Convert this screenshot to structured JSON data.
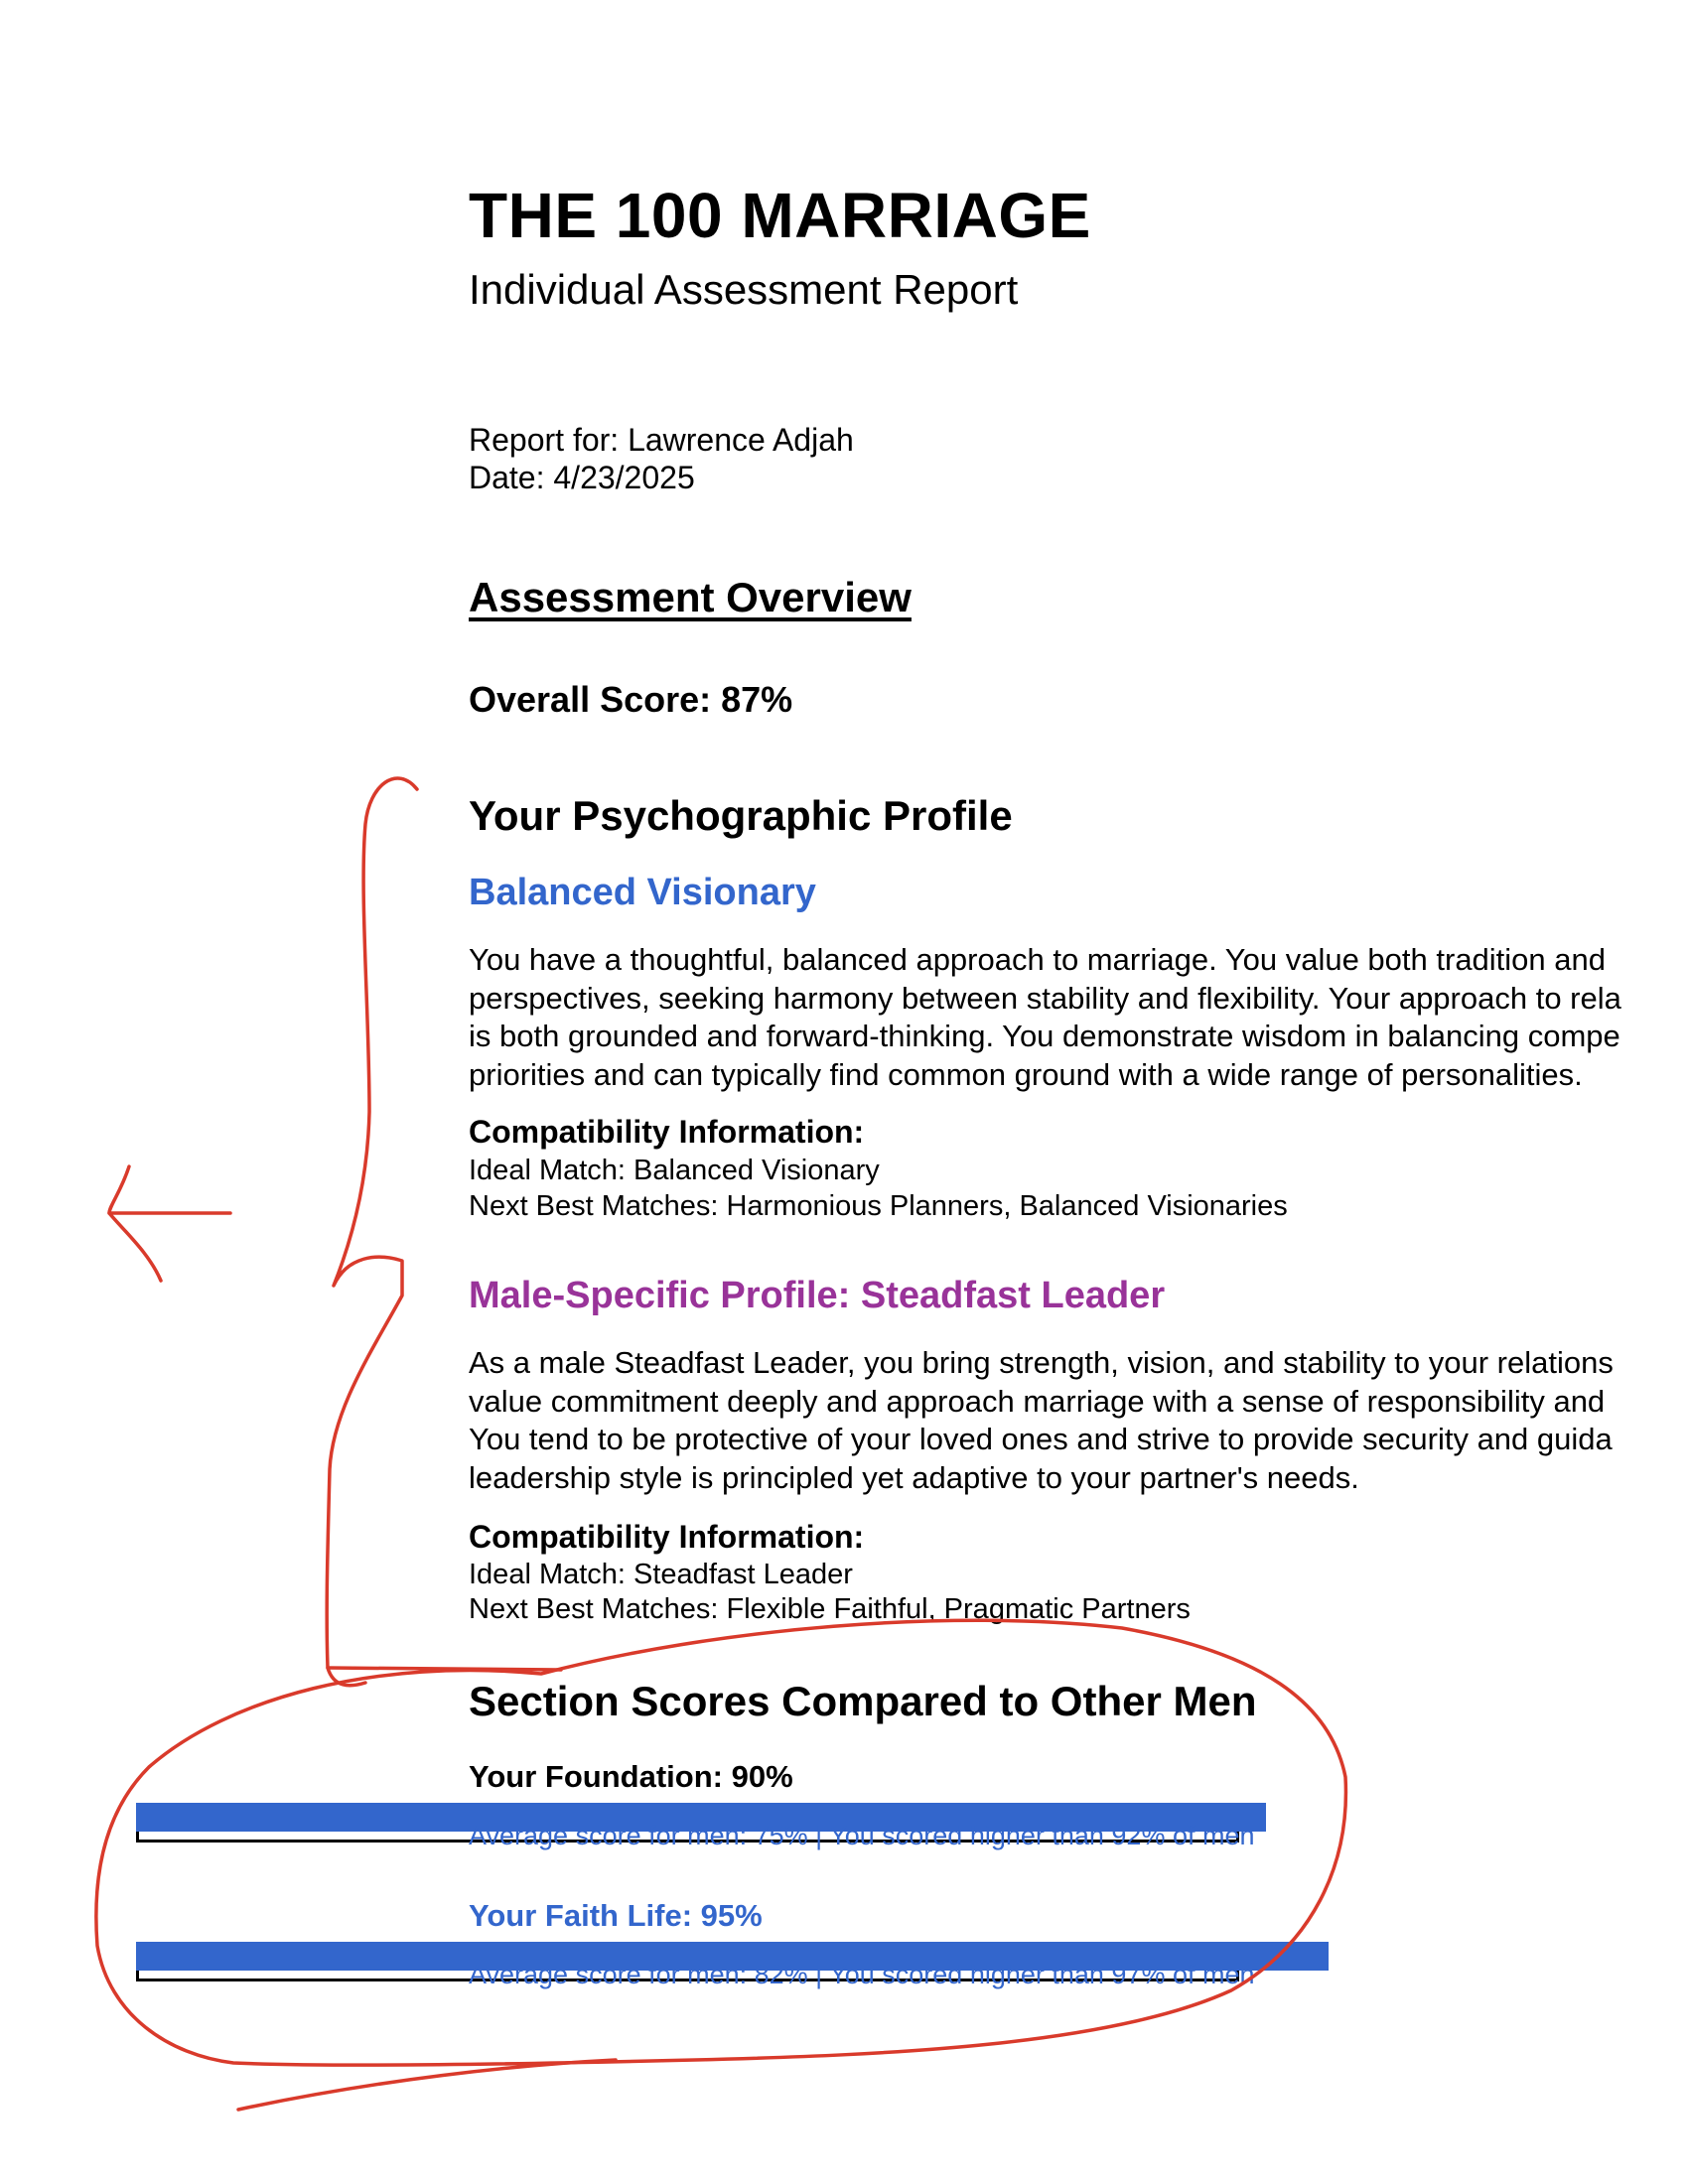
{
  "report": {
    "title": "THE 100 MARRIAGE",
    "subtitle": "Individual Assessment Report",
    "report_for": "Report for: Lawrence Adjah",
    "date": "Date: 4/23/2025"
  },
  "overview": {
    "heading": "Assessment Overview",
    "overall_score": "Overall Score: 87%"
  },
  "psychographic": {
    "heading": "Your Psychographic Profile",
    "profile_name": "Balanced Visionary",
    "description_lines": [
      "You have a thoughtful, balanced approach to marriage. You value both tradition and",
      "perspectives, seeking harmony between stability and flexibility. Your approach to rela",
      "is both grounded and forward-thinking. You demonstrate wisdom in balancing compe",
      "priorities and can typically find common ground with a wide range of personalities."
    ],
    "compat_heading": "Compatibility Information:",
    "ideal_match": "Ideal Match: Balanced Visionary",
    "next_best": "Next Best Matches: Harmonious Planners, Balanced Visionaries"
  },
  "male_profile": {
    "title": "Male-Specific Profile: Steadfast Leader",
    "description_lines": [
      "As a male Steadfast Leader, you bring strength, vision, and stability to your relations",
      "value commitment deeply and approach marriage with a sense of responsibility and",
      "You tend to be protective of your loved ones and strive to provide security and guida",
      "leadership style is principled yet adaptive to your partner's needs."
    ],
    "compat_heading": "Compatibility Information:",
    "ideal_match": "Ideal Match: Steadfast Leader",
    "next_best": "Next Best Matches: Flexible Faithful, Pragmatic Partners"
  },
  "section_scores": {
    "heading": "Section Scores Compared to Other Men",
    "items": [
      {
        "label": "Your Foundation: 90%",
        "score": 90,
        "average_text": "Average score for men: 75%    |    You scored higher than 92% of men",
        "label_color": "#000000"
      },
      {
        "label": "Your Faith Life: 95%",
        "score": 95,
        "average_text": "Average score for men: 82%    |    You scored higher than 97% of men",
        "label_color": "#3366cc"
      }
    ]
  },
  "colors": {
    "accent_blue": "#3366cc",
    "accent_purple": "#993399",
    "annotation_red": "#d93a2b"
  }
}
